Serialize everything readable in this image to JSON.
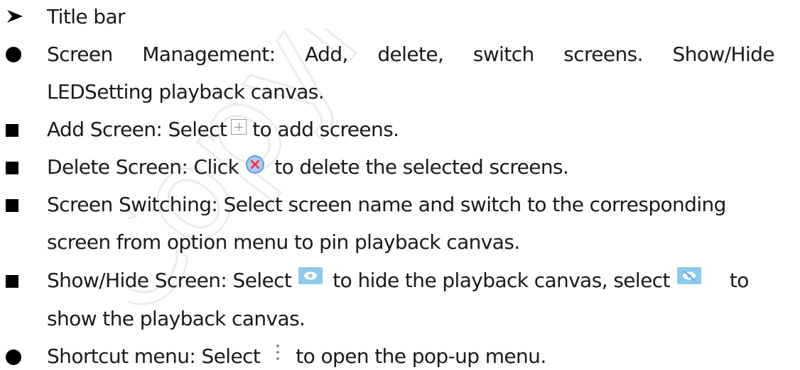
{
  "watermark": {
    "text": "Copyright Cloud Tech"
  },
  "items": {
    "title_bar": "Title bar",
    "screen_mgmt": {
      "words": [
        "Screen",
        "Management:",
        "Add,",
        "delete,",
        "switch",
        "screens.",
        "Show/Hide"
      ],
      "line2": "LEDSetting playback canvas."
    },
    "add_screen": {
      "before": "Add Screen: Select",
      "after": "to add screens."
    },
    "delete_screen": {
      "before": "Delete Screen: Click",
      "after": "to delete the selected screens."
    },
    "screen_switching": {
      "line1": "Screen Switching: Select screen name and switch to the corresponding",
      "line2": "screen from option menu to pin playback canvas."
    },
    "show_hide": {
      "before": "Show/Hide Screen: Select",
      "middle": "to hide the playback canvas, select",
      "after": "to",
      "line2": "show the playback canvas."
    },
    "shortcut": {
      "before": "Shortcut menu: Select",
      "after": "to open the pop-up menu."
    }
  },
  "icons": {
    "add": "plus-icon",
    "delete": "close-icon",
    "hide": "eye-icon",
    "show": "eye-slash-icon",
    "menu": "kebab-icon"
  },
  "colors": {
    "text": "#1a1a1a",
    "eye_icon_blue": "#8ec9ee",
    "close_icon_blue": "#5d9fe3",
    "close_icon_red": "#ff2b3d",
    "watermark": "#efefef"
  }
}
